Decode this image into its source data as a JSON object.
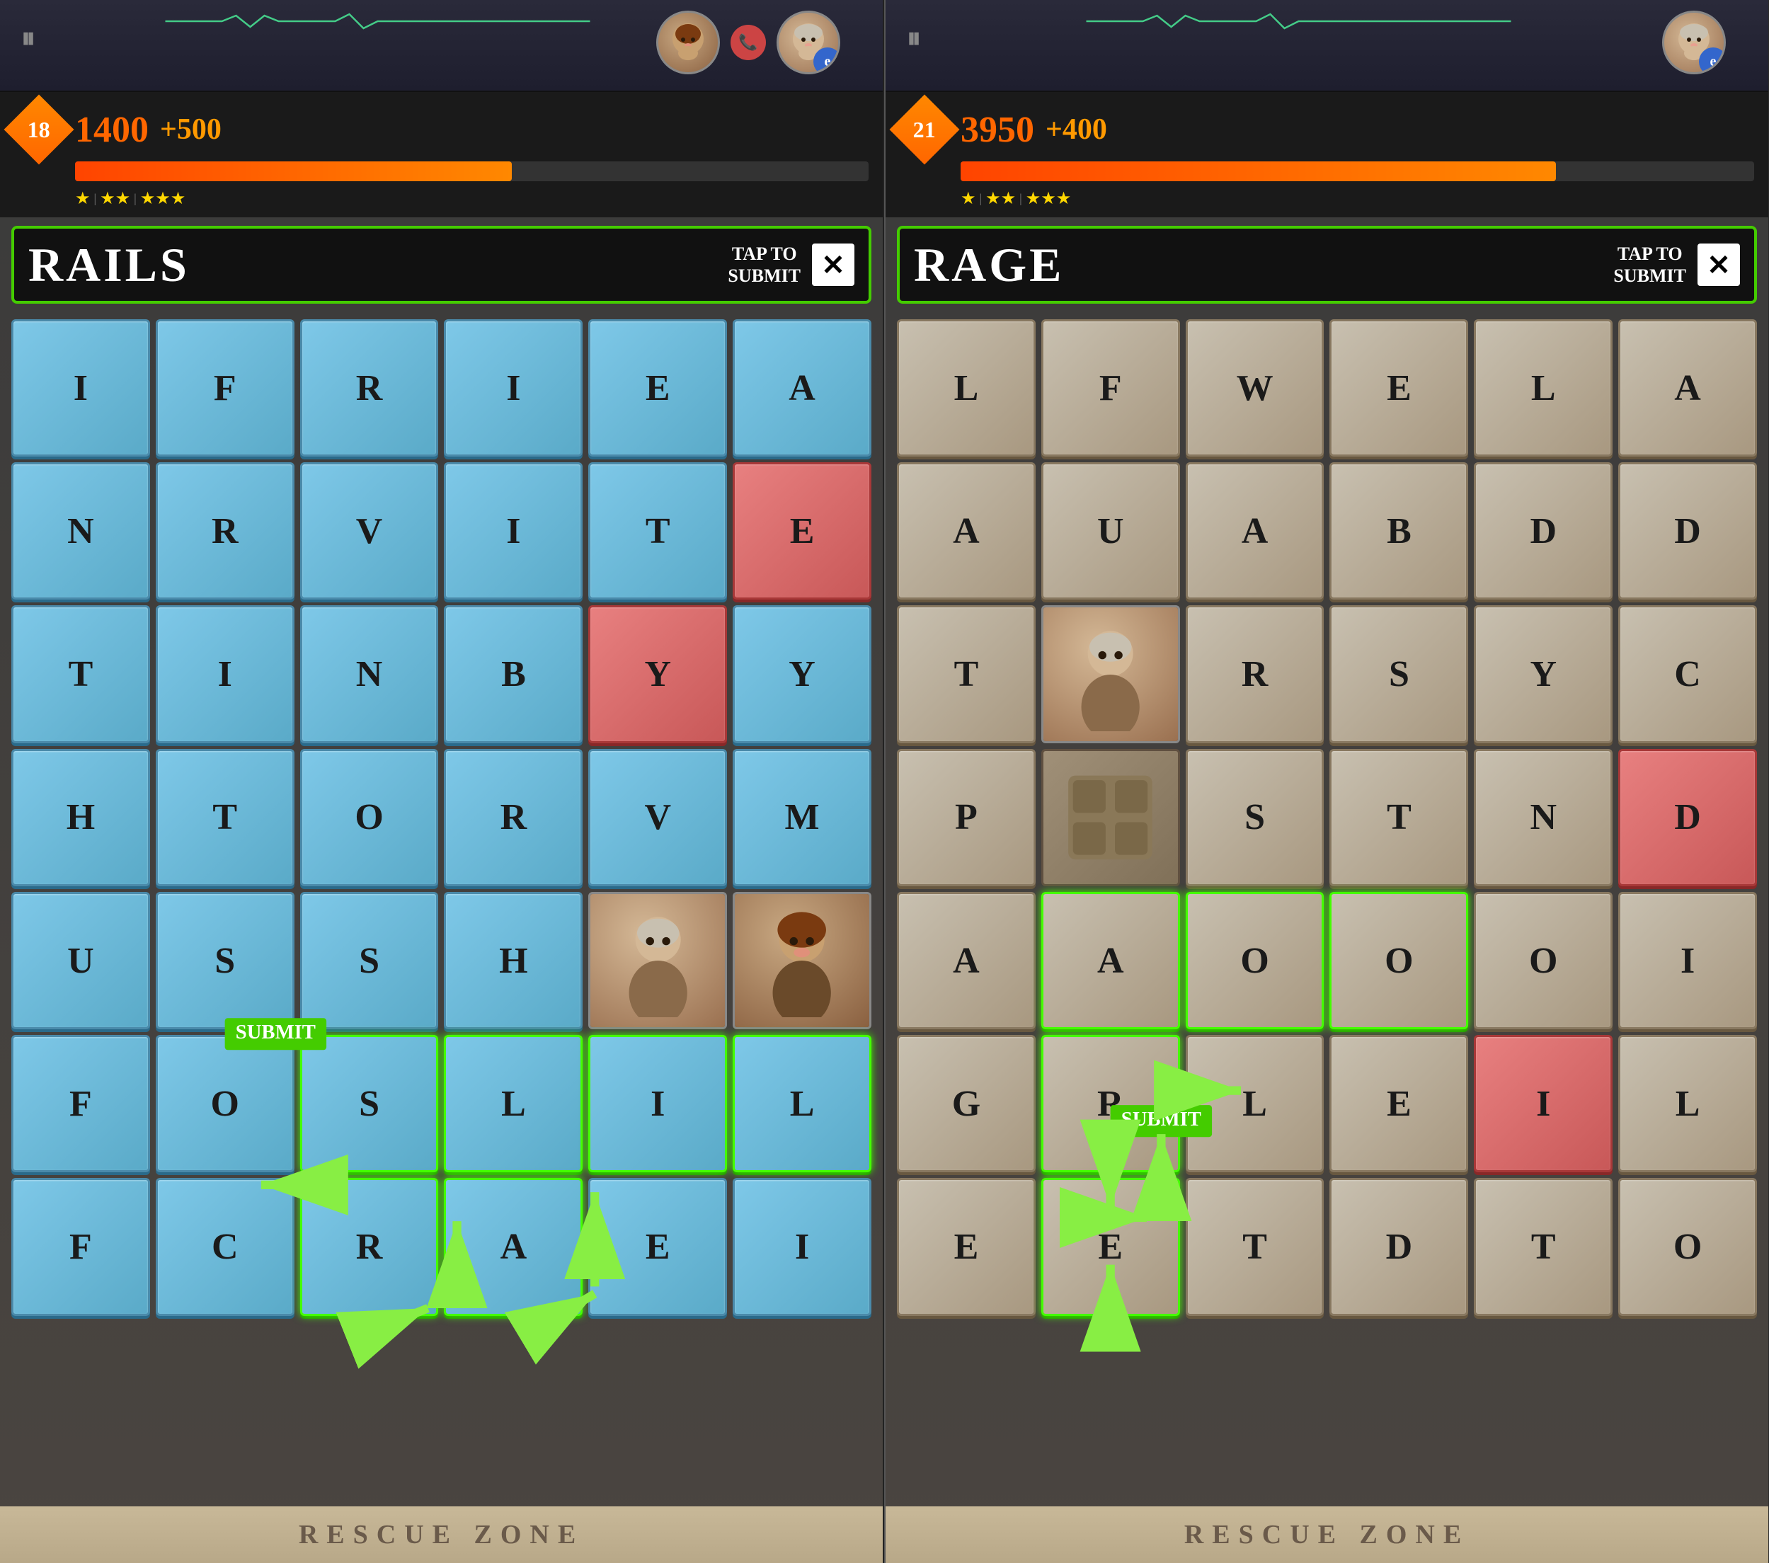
{
  "panels": [
    {
      "id": "left",
      "level": "18",
      "score": "1400",
      "bonus": "+500",
      "word": "RAILS",
      "tap_submit": "TAP TO\nSUBMIT",
      "progress_pct": 55,
      "stars": [
        1,
        2,
        3,
        4
      ],
      "grid": [
        [
          "I",
          "F",
          "R",
          "I",
          "E",
          "A"
        ],
        [
          "N",
          "R",
          "V",
          "I",
          "T",
          "E"
        ],
        [
          "T",
          "I",
          "N",
          "B",
          "Y",
          "Y"
        ],
        [
          "H",
          "T",
          "O",
          "R",
          "V",
          "M"
        ],
        [
          "U",
          "S",
          "S",
          "H",
          "CHF",
          "CHM"
        ],
        [
          "F",
          "O",
          "S",
          "L",
          "I",
          "L"
        ],
        [
          "F",
          "C",
          "R",
          "A",
          "E",
          "I"
        ]
      ],
      "tile_types": [
        [
          "blue",
          "blue",
          "blue",
          "blue",
          "blue",
          "blue"
        ],
        [
          "blue",
          "blue",
          "blue",
          "blue",
          "blue",
          "red"
        ],
        [
          "blue",
          "blue",
          "blue",
          "blue",
          "red",
          "blue"
        ],
        [
          "blue",
          "blue",
          "blue",
          "blue",
          "blue",
          "blue"
        ],
        [
          "blue",
          "blue",
          "blue",
          "blue",
          "char",
          "char"
        ],
        [
          "blue",
          "blue",
          "sel",
          "sel",
          "sel",
          "sel"
        ],
        [
          "blue",
          "blue",
          "sel",
          "sel",
          "blue",
          "blue"
        ]
      ],
      "rescue_zone": "RESCUE ZONE"
    },
    {
      "id": "right",
      "level": "21",
      "score": "3950",
      "bonus": "+400",
      "word": "RAGE",
      "tap_submit": "TAP TO\nSUBMIT",
      "progress_pct": 75,
      "stars": [
        1,
        2,
        3,
        4
      ],
      "grid": [
        [
          "L",
          "F",
          "W",
          "E",
          "L",
          "A"
        ],
        [
          "A",
          "U",
          "A",
          "B",
          "D",
          "D"
        ],
        [
          "T",
          "CHM",
          "R",
          "S",
          "Y",
          "C"
        ],
        [
          "P",
          "OBS",
          "S",
          "T",
          "N",
          "D"
        ],
        [
          "A",
          "A",
          "O",
          "O",
          "O",
          "I"
        ],
        [
          "G",
          "R",
          "L",
          "E",
          "I",
          "L"
        ],
        [
          "E",
          "E",
          "T",
          "D",
          "T",
          "O"
        ]
      ],
      "tile_types": [
        [
          "stone",
          "stone",
          "stone",
          "stone",
          "stone",
          "stone"
        ],
        [
          "stone",
          "stone",
          "stone",
          "stone",
          "stone",
          "stone"
        ],
        [
          "stone",
          "char",
          "stone",
          "stone",
          "stone",
          "stone"
        ],
        [
          "stone",
          "obs",
          "stone",
          "stone",
          "stone",
          "red"
        ],
        [
          "stone",
          "sel",
          "sel",
          "sel",
          "stone",
          "stone"
        ],
        [
          "stone",
          "sel",
          "stone",
          "stone",
          "red",
          "stone"
        ],
        [
          "stone",
          "sel",
          "stone",
          "stone",
          "stone",
          "stone"
        ]
      ],
      "rescue_zone": "RESCUE ZONE"
    }
  ]
}
